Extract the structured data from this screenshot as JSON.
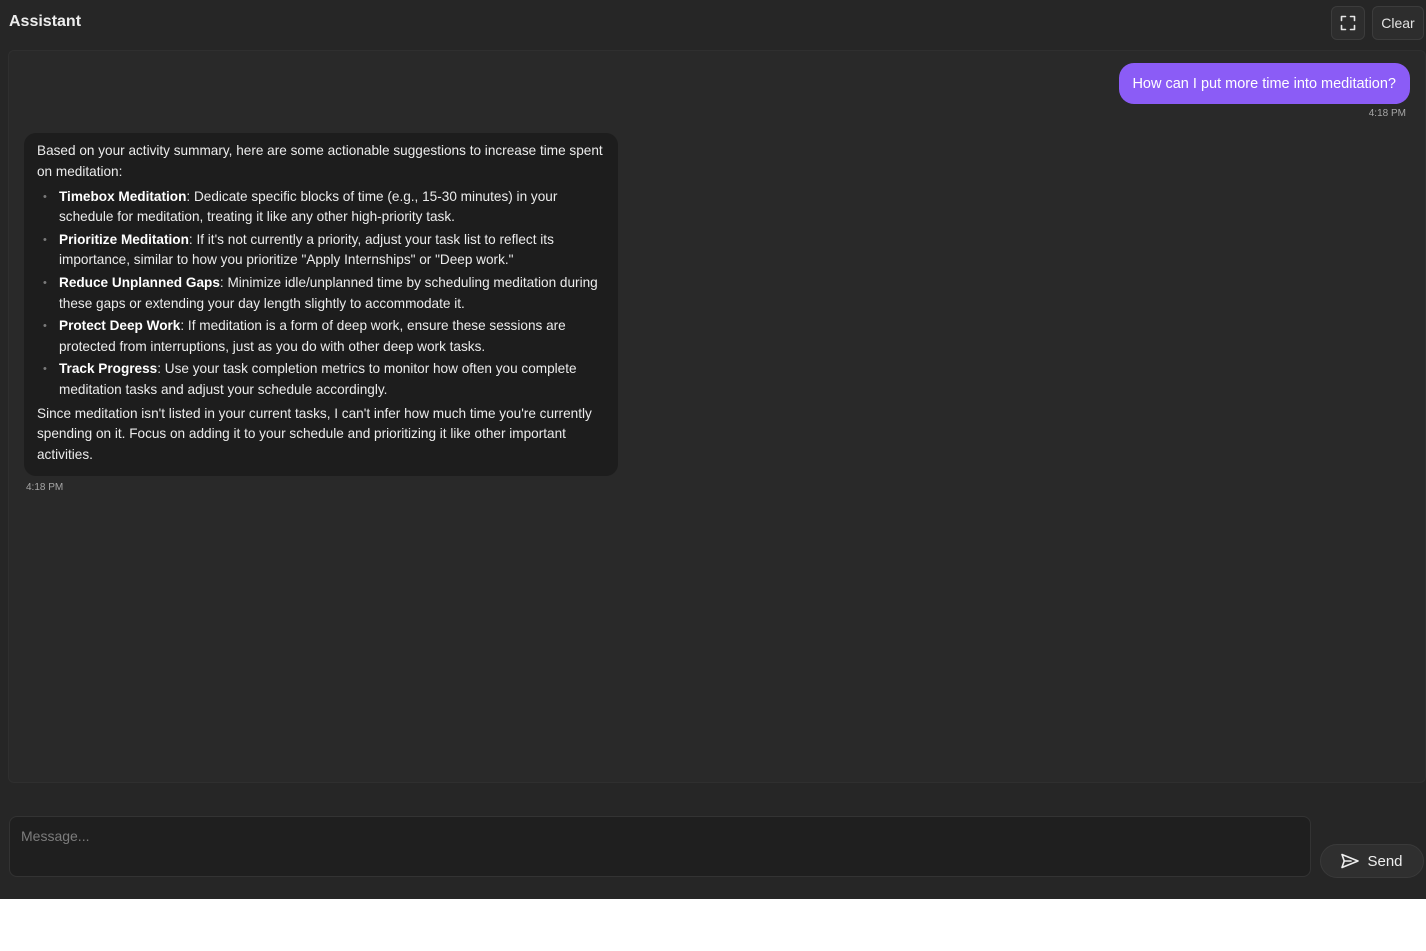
{
  "header": {
    "title": "Assistant",
    "expand_icon": "fullscreen-icon",
    "clear_label": "Clear"
  },
  "messages": {
    "user": {
      "text": "How can I put more time into meditation?",
      "time": "4:18 PM"
    },
    "assistant": {
      "intro": "Based on your activity summary, here are some actionable suggestions to increase time spent on meditation:",
      "items": [
        {
          "title": "Timebox Meditation",
          "text": ": Dedicate specific blocks of time (e.g., 15-30 minutes) in your schedule for meditation, treating it like any other high-priority task."
        },
        {
          "title": "Prioritize Meditation",
          "text": ": If it's not currently a priority, adjust your task list to reflect its importance, similar to how you prioritize \"Apply Internships\" or \"Deep work.\""
        },
        {
          "title": "Reduce Unplanned Gaps",
          "text": ": Minimize idle/unplanned time by scheduling meditation during these gaps or extending your day length slightly to accommodate it."
        },
        {
          "title": "Protect Deep Work",
          "text": ": If meditation is a form of deep work, ensure these sessions are protected from interruptions, just as you do with other deep work tasks."
        },
        {
          "title": "Track Progress",
          "text": ": Use your task completion metrics to monitor how often you complete meditation tasks and adjust your schedule accordingly."
        }
      ],
      "outro": "Since meditation isn't listed in your current tasks, I can't infer how much time you're currently spending on it. Focus on adding it to your schedule and prioritizing it like other important activities.",
      "time": "4:18 PM"
    }
  },
  "composer": {
    "placeholder": "Message...",
    "value": "",
    "send_label": "Send",
    "send_icon": "send-icon"
  },
  "colors": {
    "accent": "#8b5cf6",
    "background": "#262626",
    "assistant_bubble": "#1d1d1d"
  }
}
